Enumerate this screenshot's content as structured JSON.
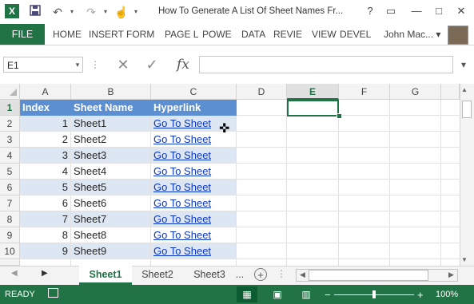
{
  "titlebar": {
    "app_icon": "X",
    "doc_title": "How To Generate A List Of Sheet Names Fr...",
    "help": "?",
    "restore": "▭",
    "minimize": "—",
    "maximize": "□",
    "close": "✕"
  },
  "ribbon": {
    "file": "FILE",
    "tabs": [
      "HOME",
      "INSERT",
      "FORM",
      "PAGE L",
      "POWE",
      "DATA",
      "REVIE",
      "VIEW",
      "DEVEL"
    ],
    "user": "John Mac...",
    "user_arrow": "▾"
  },
  "formula_bar": {
    "name_box": "E1",
    "name_arrow": "▾",
    "sep": "⋮",
    "cancel": "✕",
    "enter": "✓",
    "fx": "fx",
    "value": "",
    "expand": "▾"
  },
  "columns": [
    "A",
    "B",
    "C",
    "D",
    "E",
    "F",
    "G"
  ],
  "selected_column": "E",
  "rows": [
    "1",
    "2",
    "3",
    "4",
    "5",
    "6",
    "7",
    "8",
    "9",
    "10"
  ],
  "table": {
    "headers": [
      "Index",
      "Sheet Name",
      "Hyperlink"
    ],
    "data": [
      {
        "index": "1",
        "name": "Sheet1",
        "link": "Go To Sheet"
      },
      {
        "index": "2",
        "name": "Sheet2",
        "link": "Go To Sheet"
      },
      {
        "index": "3",
        "name": "Sheet3",
        "link": "Go To Sheet"
      },
      {
        "index": "4",
        "name": "Sheet4",
        "link": "Go To Sheet"
      },
      {
        "index": "5",
        "name": "Sheet5",
        "link": "Go To Sheet"
      },
      {
        "index": "6",
        "name": "Sheet6",
        "link": "Go To Sheet"
      },
      {
        "index": "7",
        "name": "Sheet7",
        "link": "Go To Sheet"
      },
      {
        "index": "8",
        "name": "Sheet8",
        "link": "Go To Sheet"
      },
      {
        "index": "9",
        "name": "Sheet9",
        "link": "Go To Sheet"
      }
    ]
  },
  "sheet_tabs": {
    "prev": "◀",
    "next": "▶",
    "tabs": [
      "Sheet1",
      "Sheet2",
      "Sheet3"
    ],
    "active": "Sheet1",
    "more": "...",
    "add": "+"
  },
  "scroll": {
    "up": "▲",
    "down": "▼",
    "left": "◀",
    "right": "▶"
  },
  "status": {
    "ready": "READY",
    "zoom": "100%",
    "zoom_minus": "−",
    "zoom_plus": "+",
    "normal_view": "▦",
    "page_layout": "▣",
    "page_break": "▥"
  },
  "colors": {
    "accent": "#217346",
    "header_fill": "#5b8fd1",
    "band_fill": "#dde7f3",
    "link": "#0b37c9"
  }
}
